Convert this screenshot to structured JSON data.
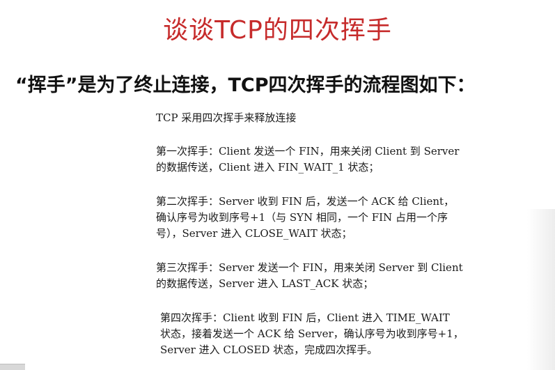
{
  "slide": {
    "title": "谈谈TCP的四次挥手",
    "subtitle": "“挥手”是为了终止连接，TCP四次挥手的流程图如下：",
    "doc": {
      "intro": "TCP 采用四次挥手来释放连接",
      "step1": [
        "第一次挥手：Client 发送一个 FIN，用来关闭 Client 到 Server",
        "的数据传送，Client 进入 FIN_WAIT_1 状态；"
      ],
      "step2": [
        "第二次挥手：Server 收到 FIN 后，发送一个 ACK 给 Client，",
        "确认序号为收到序号+1（与 SYN 相同，一个 FIN 占用一个序",
        "号），Server 进入 CLOSE_WAIT 状态；"
      ],
      "step3": [
        "第三次挥手：Server 发送一个 FIN，用来关闭 Server 到 Client",
        "的数据传送，Server 进入 LAST_ACK 状态；"
      ],
      "step4": [
        "第四次挥手：Client 收到 FIN 后，Client 进入 TIME_WAIT",
        "状态，接着发送一个 ACK 给 Server，确认序号为收到序号+1，",
        "Server 进入 CLOSED 状态，完成四次挥手。"
      ]
    }
  }
}
